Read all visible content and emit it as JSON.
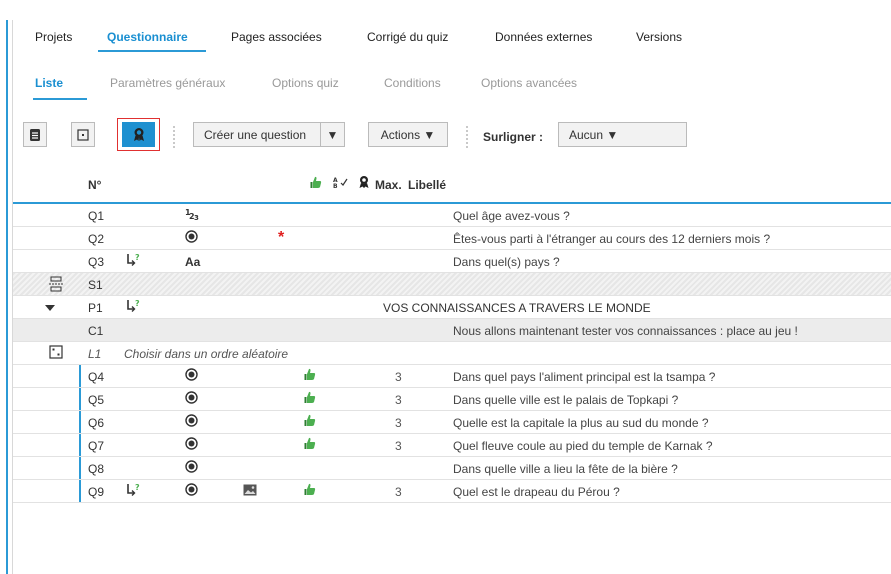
{
  "tabs": {
    "main": [
      "Projets",
      "Questionnaire",
      "Pages associées",
      "Corrigé du quiz",
      "Données externes",
      "Versions"
    ],
    "sub": [
      "Liste",
      "Paramètres généraux",
      "Options quiz",
      "Conditions",
      "Options avancées"
    ]
  },
  "toolbar": {
    "create_question": "Créer une question",
    "actions": "Actions ▼",
    "highlight_label": "Surligner :",
    "highlight_value": "Aucun ▼"
  },
  "header": {
    "num": "N°",
    "max": "Max.",
    "label": "Libellé"
  },
  "rows": [
    {
      "num": "Q1",
      "label": "Quel âge avez-vous ?"
    },
    {
      "num": "Q2",
      "label": "Êtes-vous parti à l'étranger au cours des 12 derniers mois ?",
      "required": "*"
    },
    {
      "num": "Q3",
      "label": "Dans quel(s) pays ?",
      "type": "Aa"
    },
    {
      "num": "S1"
    },
    {
      "num": "P1",
      "label": "VOS CONNAISSANCES A TRAVERS LE MONDE"
    },
    {
      "num": "C1",
      "label": "Nous allons maintenant tester vos connaissances : place au jeu !"
    },
    {
      "num": "L1",
      "label": "Choisir dans un ordre aléatoire"
    },
    {
      "num": "Q4",
      "max": "3",
      "label": "Dans quel pays l'aliment principal est la tsampa ?"
    },
    {
      "num": "Q5",
      "max": "3",
      "label": "Dans quelle ville est le palais de Topkapi ?"
    },
    {
      "num": "Q6",
      "max": "3",
      "label": "Quelle est la capitale la plus au sud du monde ?"
    },
    {
      "num": "Q7",
      "max": "3",
      "label": "Quel fleuve coule au pied du temple de Karnak ?"
    },
    {
      "num": "Q8",
      "label": "Dans quelle ville a lieu la fête de la bière ?"
    },
    {
      "num": "Q9",
      "max": "3",
      "label": "Quel est le drapeau du Pérou ?"
    }
  ]
}
